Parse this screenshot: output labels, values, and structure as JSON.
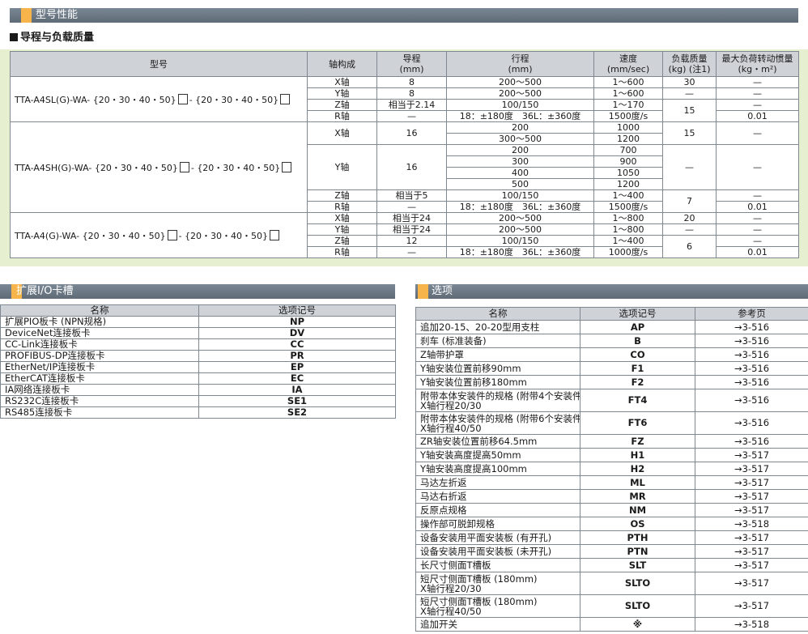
{
  "colors": {
    "section_bar": "#6b7784",
    "section_accent": "#f6b44a",
    "spec_background": "#e6efcf",
    "header_fill": "#cfd3d8"
  },
  "sections": {
    "performance": "型号性能",
    "subtitle": "导程与负载质量",
    "io": "扩展I/O卡槽",
    "options": "选项"
  },
  "spec": {
    "headers": {
      "model": "型号",
      "axis": "轴构成",
      "lead": "导程\n(mm)",
      "stroke": "行程\n(mm)",
      "speed": "速度\n(mm/sec)",
      "payload": "负载质量\n(kg) (注1)",
      "inertia": "最大负荷转动惯量\n(kg・m²)"
    },
    "models": [
      {
        "name_a": "TTA-A4SL(G)-WA- {20・30・40・50}",
        "sep": "-",
        "name_b": "{20・30・40・50}"
      },
      {
        "name_a": "TTA-A4SH(G)-WA- {20・30・40・50}",
        "sep": "-",
        "name_b": "{20・30・40・50}"
      },
      {
        "name_a": "TTA-A4(G)-WA- {20・30・40・50}",
        "sep": "-",
        "name_b": "{20・30・40・50}"
      }
    ],
    "g1": {
      "axes": [
        "X轴",
        "Y轴",
        "Z轴",
        "R轴"
      ],
      "leads": [
        "8",
        "8",
        "相当于2.14",
        "—"
      ],
      "strokes": [
        "200～500",
        "200～500",
        "100/150",
        "18：±180度　36L：±360度"
      ],
      "speeds": [
        "1～600",
        "1～600",
        "1～170",
        "1500度/s"
      ],
      "payload_x": "30",
      "payload_y": "—",
      "payload_zr": "15",
      "inertia": [
        "—",
        "—",
        "—",
        "0.01"
      ]
    },
    "g2": {
      "axes": [
        "X轴",
        "Y轴",
        "Z轴",
        "R轴"
      ],
      "leads": [
        "16",
        "16",
        "相当于5",
        "—"
      ],
      "x_strokes": [
        "200",
        "300～500"
      ],
      "x_speeds": [
        "1000",
        "1200"
      ],
      "y_strokes": [
        "200",
        "300",
        "400",
        "500"
      ],
      "y_speeds": [
        "700",
        "900",
        "1050",
        "1200"
      ],
      "z_stroke": "100/150",
      "z_speed": "1～400",
      "r_stroke": "18：±180度　36L：±360度",
      "r_speed": "1500度/s",
      "payload_x": "15",
      "payload_y": "—",
      "payload_zr": "7",
      "inertia": [
        "—",
        "—",
        "—",
        "0.01"
      ]
    },
    "g3": {
      "axes": [
        "X轴",
        "Y轴",
        "Z轴",
        "R轴"
      ],
      "leads": [
        "相当于24",
        "相当于24",
        "12",
        "—"
      ],
      "strokes": [
        "200～500",
        "200～500",
        "100/150",
        "18：±180度　36L：±360度"
      ],
      "speeds": [
        "1～800",
        "1～800",
        "1～400",
        "1000度/s"
      ],
      "payload_x": "20",
      "payload_y": "—",
      "payload_zr": "6",
      "inertia": [
        "—",
        "—",
        "—",
        "0.01"
      ]
    }
  },
  "io": {
    "headers": [
      "名称",
      "选项记号"
    ],
    "rows": [
      [
        "扩展PIO板卡 (NPN规格)",
        "NP"
      ],
      [
        "DeviceNet连接板卡",
        "DV"
      ],
      [
        "CC-Link连接板卡",
        "CC"
      ],
      [
        "PROFIBUS-DP连接板卡",
        "PR"
      ],
      [
        "EtherNet/IP连接板卡",
        "EP"
      ],
      [
        "EtherCAT连接板卡",
        "EC"
      ],
      [
        "IA网络连接板卡",
        "IA"
      ],
      [
        "RS232C连接板卡",
        "SE1"
      ],
      [
        "RS485连接板卡",
        "SE2"
      ]
    ]
  },
  "options": {
    "headers": [
      "名称",
      "选项记号",
      "参考页"
    ],
    "rows": [
      {
        "name": "追加20-15、20-20型用支柱",
        "code": "AP",
        "page": "→3-516"
      },
      {
        "name": "刹车 (标准装备)",
        "code": "B",
        "page": "→3-516"
      },
      {
        "name": "Z轴带护罩",
        "code": "CO",
        "page": "→3-516"
      },
      {
        "name": "Y轴安装位置前移90mm",
        "code": "F1",
        "page": "→3-516"
      },
      {
        "name": "Y轴安装位置前移180mm",
        "code": "F2",
        "page": "→3-516"
      },
      {
        "name": "附带本体安装件的规格 (附带4个安装件)",
        "name2": "X轴行程20/30",
        "code": "FT4",
        "page": "→3-516"
      },
      {
        "name": "附带本体安装件的规格 (附带6个安装件)",
        "name2": "X轴行程40/50",
        "code": "FT6",
        "page": "→3-516"
      },
      {
        "name": "ZR轴安装位置前移64.5mm",
        "code": "FZ",
        "page": "→3-516"
      },
      {
        "name": "Y轴安装高度提高50mm",
        "code": "H1",
        "page": "→3-517"
      },
      {
        "name": "Y轴安装高度提高100mm",
        "code": "H2",
        "page": "→3-517"
      },
      {
        "name": "马达左折返",
        "code": "ML",
        "page": "→3-517"
      },
      {
        "name": "马达右折返",
        "code": "MR",
        "page": "→3-517"
      },
      {
        "name": "反原点规格",
        "code": "NM",
        "page": "→3-517"
      },
      {
        "name": "操作部可脱卸规格",
        "code": "OS",
        "page": "→3-518"
      },
      {
        "name": "设备安装用平面安装板 (有开孔)",
        "code": "PTH",
        "page": "→3-517"
      },
      {
        "name": "设备安装用平面安装板 (未开孔)",
        "code": "PTN",
        "page": "→3-517"
      },
      {
        "name": "长尺寸侧面T槽板",
        "code": "SLT",
        "page": "→3-517"
      },
      {
        "name": "短尺寸侧面T槽板 (180mm)",
        "name2": "X轴行程20/30",
        "code": "SLTO",
        "page": "→3-517"
      },
      {
        "name": "短尺寸侧面T槽板 (180mm)",
        "name2": "X轴行程40/50",
        "code": "SLTO",
        "page": "→3-517"
      },
      {
        "name": "追加开关",
        "code": "※",
        "page": "→3-518"
      }
    ]
  }
}
